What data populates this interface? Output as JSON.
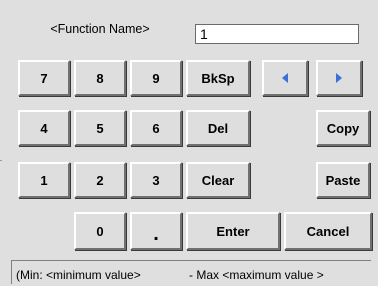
{
  "function_name_label": "<Function Name>",
  "input_value": "1",
  "keys": {
    "k7": "7",
    "k8": "8",
    "k9": "9",
    "k4": "4",
    "k5": "5",
    "k6": "6",
    "k1": "1",
    "k2": "2",
    "k3": "3",
    "k0": "0",
    "dot": "."
  },
  "actions": {
    "bksp": "BkSp",
    "del": "Del",
    "clear": "Clear",
    "enter": "Enter",
    "copy": "Copy",
    "paste": "Paste",
    "cancel": "Cancel"
  },
  "icons": {
    "left": "arrow-left-icon",
    "right": "arrow-right-icon"
  },
  "colors": {
    "arrow": "#3b6fd6",
    "background": "#dfdfdf"
  },
  "status": {
    "min_text": "(Min: <minimum value>",
    "max_text": "- Max  <maximum value >"
  }
}
